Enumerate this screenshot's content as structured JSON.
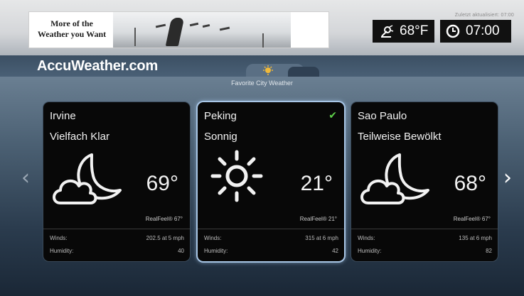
{
  "ad": {
    "headline_line1": "More of the",
    "headline_line2": "Weather you Want"
  },
  "status": {
    "updated": "Zuletzt aktualisiert: 07:00",
    "current_temp": "68°F",
    "time": "07:00"
  },
  "header": {
    "logo": "AccuWeather.com",
    "section_title": "Favorite City Weather"
  },
  "nav": {
    "prev": "‹",
    "next": "›"
  },
  "cities": [
    {
      "city": "Irvine",
      "condition": "Vielfach Klar",
      "icon": "cloudy-moon-icon",
      "temp": "69°",
      "realfeel": "RealFeel® 67°",
      "winds_label": "Winds:",
      "winds": "202.5 at 5 mph",
      "humidity_label": "Humidity:",
      "humidity": "40",
      "selected": false
    },
    {
      "city": "Peking",
      "condition": "Sonnig",
      "icon": "sun-icon",
      "temp": "21°",
      "realfeel": "RealFeel® 21°",
      "winds_label": "Winds:",
      "winds": "315 at 6 mph",
      "humidity_label": "Humidity:",
      "humidity": "42",
      "selected": true,
      "check": "✔"
    },
    {
      "city": "Sao Paulo",
      "condition": "Teilweise Bewölkt",
      "icon": "cloudy-moon-icon",
      "temp": "68°",
      "realfeel": "RealFeel® 67°",
      "winds_label": "Winds:",
      "winds": "135 at 6 mph",
      "humidity_label": "Humidity:",
      "humidity": "82",
      "selected": false
    }
  ],
  "colors": {
    "selected_border": "#a8c6e6",
    "check": "#5ed04a",
    "card_bg": "#080808"
  }
}
